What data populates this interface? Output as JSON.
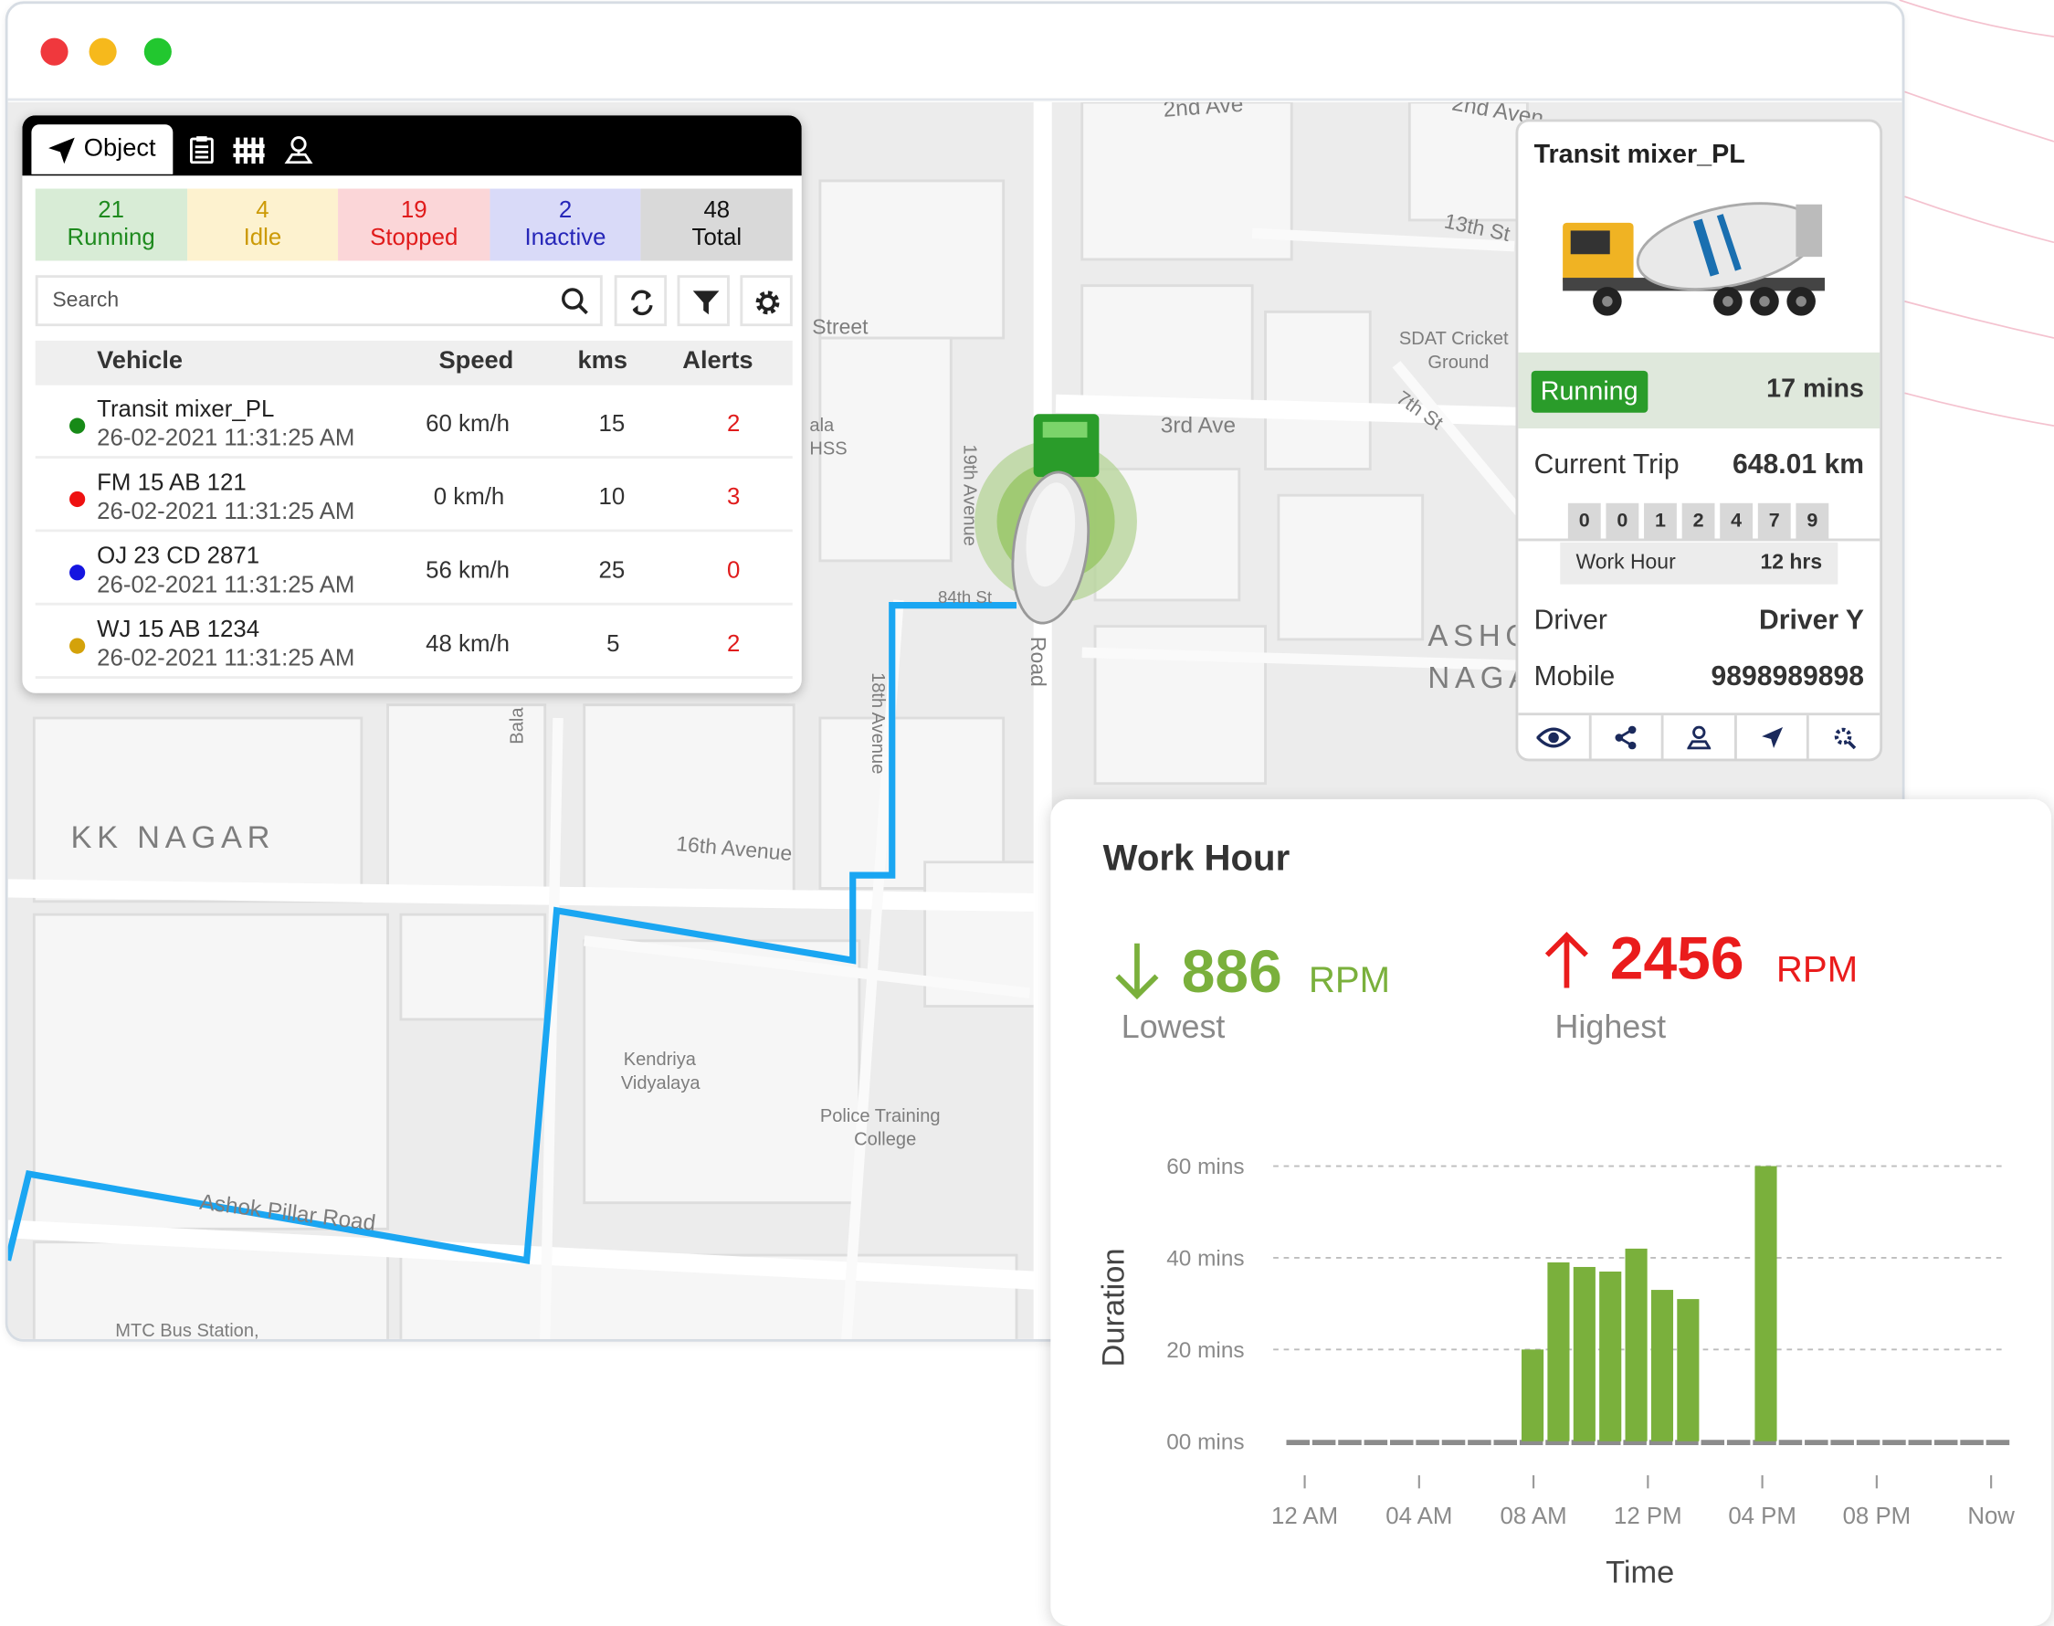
{
  "window": {
    "controls": [
      "close",
      "minimize",
      "maximize"
    ],
    "colors": {
      "close": "#f0383d",
      "minimize": "#f6b91c",
      "maximize": "#22c72f"
    }
  },
  "map": {
    "labels": {
      "street_2nd_ave": "2nd Ave",
      "street_2nd_avenue": "2nd Aven",
      "street_13th": "13th St",
      "street_street": "Street",
      "street_ala": "ala",
      "street_hss": "HSS",
      "street_19th": "19th Avenue",
      "street_3rd": "3rd Ave",
      "street_7th": "7th St",
      "street_84th": "84th St",
      "street_road": "Road",
      "street_18th": "18th Avenue",
      "street_bala": "Bala",
      "area_ashok": "ASHO",
      "area_nagar": "NAGA",
      "sdat1": "SDAT Cricket",
      "sdat2": "Ground",
      "kk_nagar": "KK NAGAR",
      "street_16th": "16th Avenue",
      "kendriya1": "Kendriya",
      "kendriya2": "Vidyalaya",
      "police1": "Police Training",
      "police2": "College",
      "ashok_pillar": "Ashok Pillar Road",
      "mtc": "MTC Bus Station,"
    },
    "route_color": "#1aa6f2"
  },
  "object_panel": {
    "tabs": [
      {
        "label": "Object",
        "icon": "navigation-arrow-icon",
        "active": true
      },
      {
        "label": "",
        "icon": "clipboard-icon"
      },
      {
        "label": "",
        "icon": "fence-icon"
      },
      {
        "label": "",
        "icon": "map-pin-icon"
      }
    ],
    "stats": [
      {
        "count": "21",
        "label": "Running",
        "bg": "#d8ecd6",
        "color": "#1e8a1e"
      },
      {
        "count": "4",
        "label": "Idle",
        "bg": "#fdf2cf",
        "color": "#cc9a06"
      },
      {
        "count": "19",
        "label": "Stopped",
        "bg": "#fbd6d8",
        "color": "#e01b1b"
      },
      {
        "count": "2",
        "label": "Inactive",
        "bg": "#d9daf8",
        "color": "#2626b8"
      },
      {
        "count": "48",
        "label": "Total",
        "bg": "#d9d9d9",
        "color": "#111111"
      }
    ],
    "search_placeholder": "Search",
    "columns": {
      "vehicle": "Vehicle",
      "speed": "Speed",
      "kms": "kms",
      "alerts": "Alerts"
    },
    "rows": [
      {
        "name": "Transit mixer_PL",
        "time": "26-02-2021 11:31:25 AM",
        "speed": "60 km/h",
        "kms": "15",
        "alerts": "2",
        "status_color": "#178a17"
      },
      {
        "name": "FM 15 AB 121",
        "time": "26-02-2021 11:31:25 AM",
        "speed": "0 km/h",
        "kms": "10",
        "alerts": "3",
        "status_color": "#ee1111"
      },
      {
        "name": "OJ 23 CD 2871",
        "time": "26-02-2021 11:31:25 AM",
        "speed": "56 km/h",
        "kms": "25",
        "alerts": "0",
        "status_color": "#1515e0"
      },
      {
        "name": "WJ 15 AB 1234",
        "time": "26-02-2021 11:31:25 AM",
        "speed": "48 km/h",
        "kms": "5",
        "alerts": "2",
        "status_color": "#d4a20a"
      }
    ]
  },
  "vehicle_card": {
    "title": "Transit mixer_PL",
    "status": "Running",
    "duration": "17 mins",
    "current_trip_label": "Current Trip",
    "current_trip_value": "648.01 km",
    "odometer": [
      "0",
      "0",
      "1",
      "2",
      "4",
      "7",
      "9"
    ],
    "work_hour_label": "Work Hour",
    "work_hour_value": "12 hrs",
    "driver_label": "Driver",
    "driver_value": "Driver Y",
    "mobile_label": "Mobile",
    "mobile_value": "9898989898",
    "actions": [
      "eye-icon",
      "share-icon",
      "pin-icon",
      "navigation-icon",
      "settings-icon"
    ]
  },
  "work_hour": {
    "title": "Work Hour",
    "lowest_value": "886",
    "lowest_unit": "RPM",
    "lowest_label": "Lowest",
    "highest_value": "2456",
    "highest_unit": "RPM",
    "highest_label": "Highest",
    "colors": {
      "low": "#7ab03c",
      "high": "#ea1c1c",
      "bar": "#7ab03c",
      "base": "#8c8c8c"
    }
  },
  "chart_data": {
    "type": "bar",
    "xlabel": "Time",
    "ylabel": "Duration",
    "ylim": [
      0,
      60
    ],
    "yticks": [
      {
        "value": 60,
        "label": "60 mins"
      },
      {
        "value": 40,
        "label": "40 mins"
      },
      {
        "value": 20,
        "label": "20 mins"
      },
      {
        "value": 0,
        "label": "00 mins"
      }
    ],
    "xticks": [
      {
        "index": 0,
        "label": "12 AM"
      },
      {
        "index": 4,
        "label": "04 AM"
      },
      {
        "index": 8,
        "label": "08 AM"
      },
      {
        "index": 12,
        "label": "12 PM"
      },
      {
        "index": 16,
        "label": "04 PM"
      },
      {
        "index": 20,
        "label": "08 PM"
      },
      {
        "index": 24,
        "label": "Now"
      }
    ],
    "values": [
      0,
      0,
      0,
      0,
      0,
      0,
      0,
      0,
      0,
      20,
      39,
      38,
      37,
      42,
      33,
      31,
      0,
      0,
      60,
      0,
      0,
      0,
      0,
      0,
      0,
      0,
      0,
      0
    ],
    "grid": true
  }
}
